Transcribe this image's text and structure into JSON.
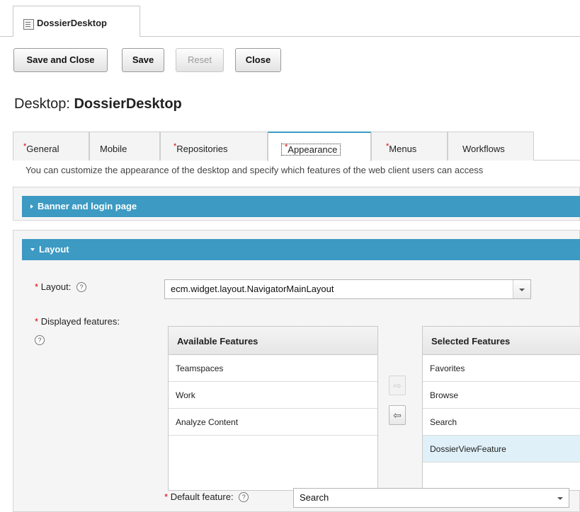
{
  "doc_tab": {
    "label": "DossierDesktop"
  },
  "toolbar": {
    "save_close": "Save and Close",
    "save": "Save",
    "reset": "Reset",
    "close": "Close"
  },
  "page": {
    "title_prefix": "Desktop: ",
    "title_name": "DossierDesktop"
  },
  "tabs": [
    {
      "label": "General",
      "required": "*"
    },
    {
      "label": "Mobile",
      "required": ""
    },
    {
      "label": "Repositories",
      "required": "*"
    },
    {
      "label": "Appearance",
      "required": "*"
    },
    {
      "label": "Menus",
      "required": "*"
    },
    {
      "label": "Workflows",
      "required": ""
    }
  ],
  "description": "You can customize the appearance of the desktop and specify which features of the web client users can access",
  "sections": {
    "banner": {
      "title": "Banner and login page"
    },
    "layout": {
      "title": "Layout"
    }
  },
  "layout_field": {
    "label": "Layout:",
    "value": "ecm.widget.layout.NavigatorMainLayout"
  },
  "features_field": {
    "label": "Displayed features:"
  },
  "available": {
    "header": "Available Features",
    "items": [
      "Teamspaces",
      "Work",
      "Analyze Content"
    ]
  },
  "selected": {
    "header": "Selected Features",
    "items": [
      "Favorites",
      "Browse",
      "Search",
      "DossierViewFeature"
    ]
  },
  "default_feature": {
    "label": "Default feature:",
    "value": "Search"
  },
  "required_mark": "*",
  "help_glyph": "?",
  "colors": {
    "section_header": "#3c9ac3",
    "selected_row": "#dff0f8",
    "required": "#dd0000"
  }
}
